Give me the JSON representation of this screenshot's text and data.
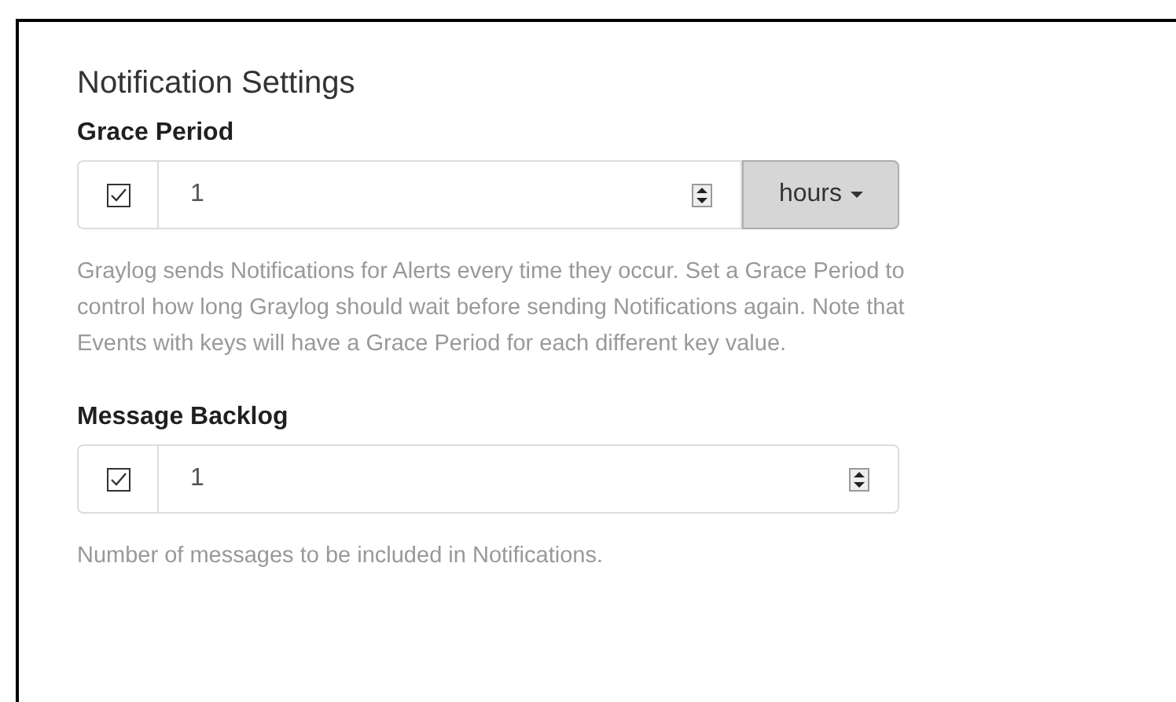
{
  "title": "Notification Settings",
  "fields": [
    {
      "label": "Grace Period",
      "checked": true,
      "value": "1",
      "unit": "hours",
      "help": "Graylog sends Notifications for Alerts every time they occur. Set a Grace Period to control how long Graylog should wait before sending Notifications again. Note that Events with keys will have a Grace Period for each different key value."
    },
    {
      "label": "Message Backlog",
      "checked": true,
      "value": "1",
      "help": "Number of messages to be included in Notifications."
    }
  ]
}
